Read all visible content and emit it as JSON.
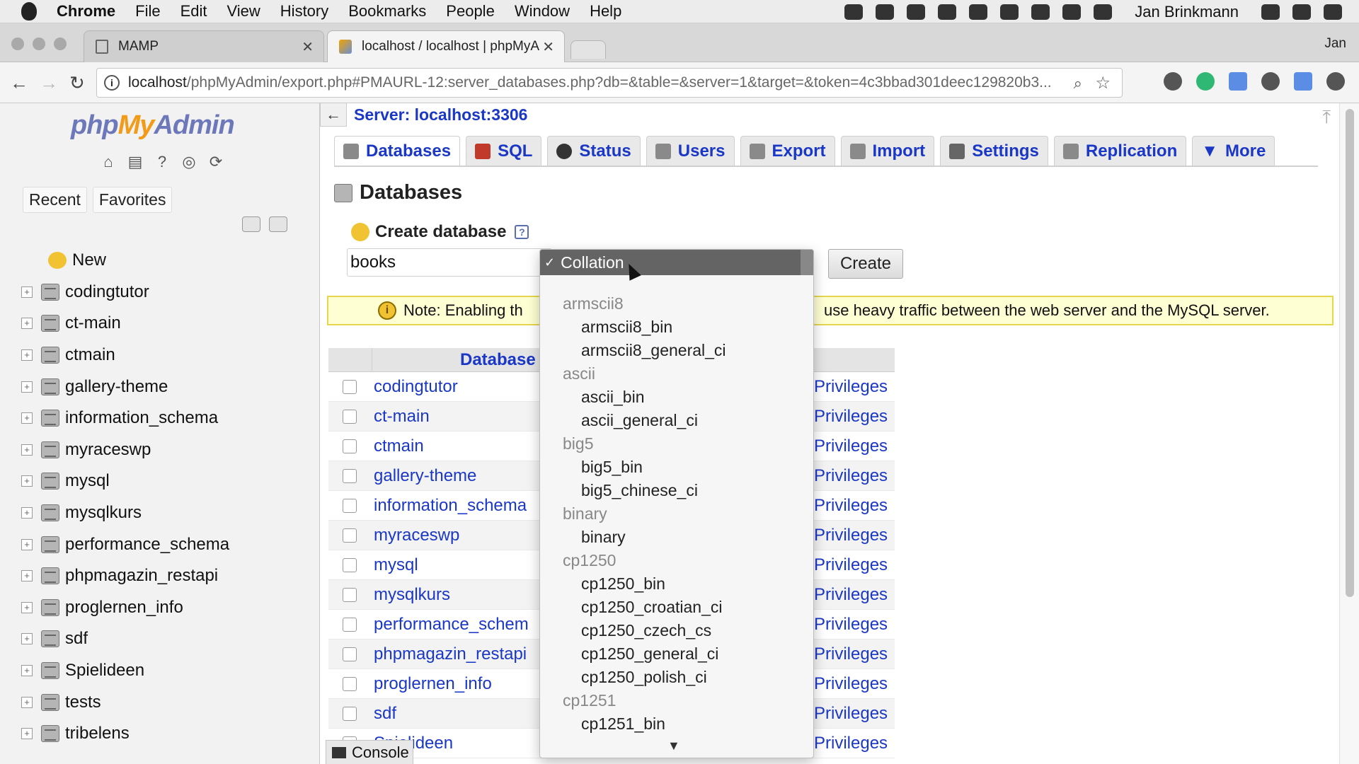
{
  "menubar": {
    "app": "Chrome",
    "items": [
      "File",
      "Edit",
      "View",
      "History",
      "Bookmarks",
      "People",
      "Window",
      "Help"
    ],
    "user": "Jan Brinkmann"
  },
  "tabs": [
    {
      "title": "MAMP"
    },
    {
      "title": "localhost / localhost | phpMyA"
    }
  ],
  "profile": "Jan",
  "address": {
    "host": "localhost",
    "path": "/phpMyAdmin/export.php#PMAURL-12:server_databases.php?db=&table=&server=1&target=&token=4c3bbad301deec129820b3..."
  },
  "sidebar": {
    "logo_php": "php",
    "logo_my": "My",
    "logo_admin": "Admin",
    "recent": "Recent",
    "favorites": "Favorites",
    "new": "New",
    "databases": [
      "codingtutor",
      "ct-main",
      "ctmain",
      "gallery-theme",
      "information_schema",
      "myraceswp",
      "mysql",
      "mysqlkurs",
      "performance_schema",
      "phpmagazin_restapi",
      "proglernen_info",
      "sdf",
      "Spielideen",
      "tests",
      "tribelens"
    ]
  },
  "server": {
    "title": "Server: localhost:3306"
  },
  "nav": {
    "tabs": [
      "Databases",
      "SQL",
      "Status",
      "Users",
      "Export",
      "Import",
      "Settings",
      "Replication",
      "More"
    ]
  },
  "page": {
    "heading": "Databases",
    "create_label": "Create database",
    "dbname_value": "books",
    "create_button": "Create",
    "note_part1": "Note: Enabling th",
    "note_part2": "use heavy traffic between the web server and the MySQL server."
  },
  "table": {
    "header": "Database",
    "privileges": "Privileges",
    "rows": [
      "codingtutor",
      "ct-main",
      "ctmain",
      "gallery-theme",
      "information_schema",
      "myraceswp",
      "mysql",
      "mysqlkurs",
      "performance_schem",
      "phpmagazin_restapi",
      "proglernen_info",
      "sdf",
      "Spielideen"
    ]
  },
  "collation": {
    "selected": "Collation",
    "entries": [
      {
        "type": "group",
        "label": "armscii8"
      },
      {
        "type": "option",
        "label": "armscii8_bin"
      },
      {
        "type": "option",
        "label": "armscii8_general_ci"
      },
      {
        "type": "group",
        "label": "ascii"
      },
      {
        "type": "option",
        "label": "ascii_bin"
      },
      {
        "type": "option",
        "label": "ascii_general_ci"
      },
      {
        "type": "group",
        "label": "big5"
      },
      {
        "type": "option",
        "label": "big5_bin"
      },
      {
        "type": "option",
        "label": "big5_chinese_ci"
      },
      {
        "type": "group",
        "label": "binary"
      },
      {
        "type": "option",
        "label": "binary"
      },
      {
        "type": "group",
        "label": "cp1250"
      },
      {
        "type": "option",
        "label": "cp1250_bin"
      },
      {
        "type": "option",
        "label": "cp1250_croatian_ci"
      },
      {
        "type": "option",
        "label": "cp1250_czech_cs"
      },
      {
        "type": "option",
        "label": "cp1250_general_ci"
      },
      {
        "type": "option",
        "label": "cp1250_polish_ci"
      },
      {
        "type": "group",
        "label": "cp1251"
      },
      {
        "type": "option",
        "label": "cp1251_bin"
      }
    ]
  },
  "console": "Console"
}
